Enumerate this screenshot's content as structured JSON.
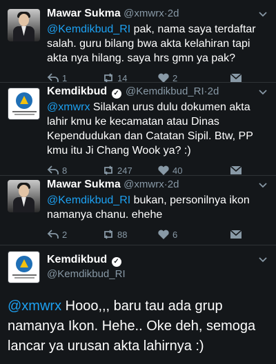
{
  "tweets": [
    {
      "name": "Mawar Sukma",
      "handle": "@xmwrx",
      "dot": "·",
      "time": "2d",
      "mention": "@Kemdikbud_RI",
      "body": " pak, nama saya terdaftar salah. guru bilang bwa akta kelahiran tapi akta nya hilang. saya hrs gmn ya pak?",
      "replies": "1",
      "retweets": "14",
      "likes": "2"
    },
    {
      "name": "Kemdikbud",
      "handle": "@Kemdikbud_RI",
      "dot": "·",
      "time": "2d",
      "mention": "@xmwrx",
      "body": " Silakan urus dulu dokumen akta lahir kmu ke kecamatan atau Dinas Kependudukan dan Catatan Sipil. Btw, PP kmu itu Ji Chang Wook ya? :)",
      "replies": "8",
      "retweets": "247",
      "likes": "40"
    },
    {
      "name": "Mawar Sukma",
      "handle": "@xmwrx",
      "dot": "·",
      "time": "2d",
      "mention": "@Kemdikbud_RI",
      "body": " bukan, personilnya ikon namanya chanu. ehehe",
      "replies": "2",
      "retweets": "88",
      "likes": "6"
    }
  ],
  "main_tweet": {
    "name": "Kemdikbud",
    "handle": "@Kemdikbud_RI",
    "mention": "@xmwrx",
    "body": " Hooo,,, baru tau ada grup namanya Ikon. Hehe.. Oke deh, semoga lancar ya urusan akta lahirnya :)"
  },
  "icons": {
    "reply": "reply-icon",
    "retweet": "retweet-icon",
    "like": "heart-icon",
    "dm": "direct-message-icon",
    "more": "chevron-down-icon",
    "verified": "verified-badge-icon"
  },
  "colors": {
    "background": "#14171a",
    "link": "#1da1f2",
    "muted": "#8899a6",
    "divider": "#2f3336"
  }
}
